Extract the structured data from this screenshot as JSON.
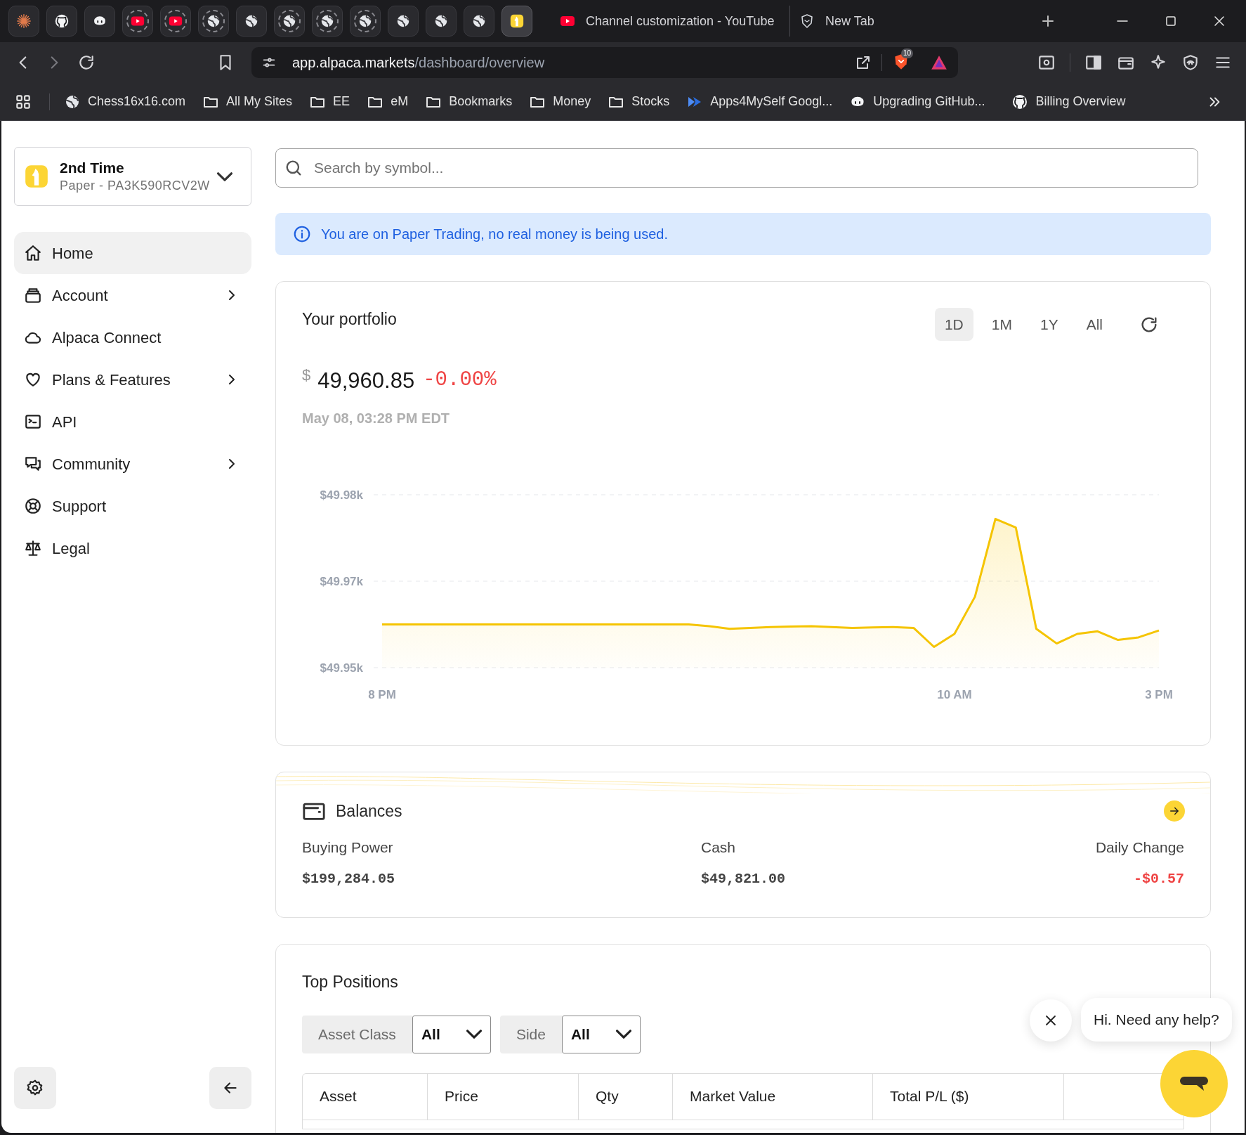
{
  "browser": {
    "pinned_tabs": [
      {
        "kind": "burst",
        "selected": false,
        "sleeping": false
      },
      {
        "kind": "cat",
        "selected": false,
        "sleeping": false
      },
      {
        "kind": "robot",
        "selected": false,
        "sleeping": false
      },
      {
        "kind": "play",
        "selected": false,
        "sleeping": true
      },
      {
        "kind": "play",
        "selected": false,
        "sleeping": true
      },
      {
        "kind": "globe",
        "selected": false,
        "sleeping": true
      },
      {
        "kind": "globe",
        "selected": false,
        "sleeping": false
      },
      {
        "kind": "globe",
        "selected": false,
        "sleeping": true
      },
      {
        "kind": "globe",
        "selected": false,
        "sleeping": true
      },
      {
        "kind": "globe",
        "selected": false,
        "sleeping": true
      },
      {
        "kind": "globe",
        "selected": false,
        "sleeping": false
      },
      {
        "kind": "globe",
        "selected": false,
        "sleeping": false
      },
      {
        "kind": "globe",
        "selected": false,
        "sleeping": false
      },
      {
        "kind": "alpaca",
        "selected": true,
        "sleeping": false
      }
    ],
    "tabs": [
      {
        "title": "Channel customization - YouTube",
        "kind": "play",
        "selected": false
      },
      {
        "title": "New Tab",
        "kind": "shield",
        "selected": false
      }
    ],
    "address": {
      "domain": "app.alpaca.markets",
      "path": "/dashboard/overview"
    },
    "extension_badge": "10",
    "bookmarks": [
      {
        "label": "Chess16x16.com",
        "kind": "globe"
      },
      {
        "label": "All My Sites",
        "kind": "folder"
      },
      {
        "label": "EE",
        "kind": "folder"
      },
      {
        "label": "eM",
        "kind": "folder"
      },
      {
        "label": "Bookmarks",
        "kind": "folder"
      },
      {
        "label": "Money",
        "kind": "folder"
      },
      {
        "label": "Stocks",
        "kind": "folder"
      },
      {
        "label": "Apps4MySelf Googl...",
        "kind": "arrow"
      },
      {
        "label": "Upgrading GitHub...",
        "kind": "robot"
      },
      {
        "label": "Billing Overview",
        "kind": "cat"
      }
    ]
  },
  "account": {
    "name": "2nd Time",
    "subtitle": "Paper - PA3K590RCV2W"
  },
  "nav": [
    {
      "label": "Home",
      "kind": "home",
      "selected": true,
      "has_submenu": false
    },
    {
      "label": "Account",
      "kind": "cards",
      "selected": false,
      "has_submenu": true
    },
    {
      "label": "Alpaca Connect",
      "kind": "cloud",
      "selected": false,
      "has_submenu": false
    },
    {
      "label": "Plans & Features",
      "kind": "heart",
      "selected": false,
      "has_submenu": true
    },
    {
      "label": "API",
      "kind": "terminal",
      "selected": false,
      "has_submenu": false
    },
    {
      "label": "Community",
      "kind": "chats",
      "selected": false,
      "has_submenu": true
    },
    {
      "label": "Support",
      "kind": "lifebuoy",
      "selected": false,
      "has_submenu": false
    },
    {
      "label": "Legal",
      "kind": "scales",
      "selected": false,
      "has_submenu": false
    }
  ],
  "search": {
    "placeholder": "Search by symbol..."
  },
  "notice": "You are on Paper Trading, no real money is being used.",
  "portfolio": {
    "title": "Your portfolio",
    "ranges": [
      {
        "label": "1D",
        "selected": true
      },
      {
        "label": "1M",
        "selected": false
      },
      {
        "label": "1Y",
        "selected": false
      },
      {
        "label": "All",
        "selected": false
      }
    ],
    "currency": "$",
    "value": "49,960.85",
    "change": "-0.00%",
    "timestamp": "May 08, 03:28 PM EDT",
    "chart_data": {
      "type": "area",
      "categories": [
        "8 PM",
        null,
        null,
        null,
        null,
        null,
        null,
        null,
        null,
        null,
        null,
        null,
        null,
        null,
        null,
        null,
        null,
        null,
        null,
        null,
        null,
        null,
        null,
        null,
        null,
        null,
        null,
        null,
        "10 AM",
        null,
        null,
        null,
        null,
        null,
        null,
        null,
        null,
        null,
        "3 PM"
      ],
      "series": [
        {
          "color": "#f5c400",
          "values": [
            49.96,
            49.96,
            49.96,
            49.96,
            49.96,
            49.96,
            49.96,
            49.96,
            49.96,
            49.96,
            49.96,
            49.96,
            49.96,
            49.96,
            49.96,
            49.96,
            49.9598,
            49.9595,
            49.9596,
            49.9597,
            49.95975,
            49.9598,
            49.9597,
            49.9596,
            49.95965,
            49.9597,
            49.9596,
            49.9574,
            49.9589,
            49.9632,
            49.9722,
            49.9712,
            49.9595,
            49.9578,
            49.9589,
            49.9592,
            49.9582,
            49.9585,
            49.9593
          ]
        }
      ],
      "ylim": [
        49.955,
        49.975
      ],
      "yticks": [
        {
          "value": 49.975,
          "label": "$49.98k"
        },
        {
          "value": 49.965,
          "label": "$49.97k"
        },
        {
          "value": 49.955,
          "label": "$49.95k"
        }
      ]
    }
  },
  "balances": {
    "title": "Balances",
    "items": [
      {
        "label": "Buying Power",
        "value": "$199,284.05",
        "negative": false
      },
      {
        "label": "Cash",
        "value": "$49,821.00",
        "negative": false
      },
      {
        "label": "Daily Change",
        "value": "-$0.57",
        "negative": true
      }
    ]
  },
  "positions": {
    "title": "Top Positions",
    "filters": [
      {
        "label": "Asset Class",
        "value": "All"
      },
      {
        "label": "Side",
        "value": "All"
      }
    ],
    "columns": [
      "Asset",
      "Price",
      "Qty",
      "Market Value",
      "Total P/L ($)"
    ]
  },
  "chat": {
    "message": "Hi. Need any help?"
  }
}
